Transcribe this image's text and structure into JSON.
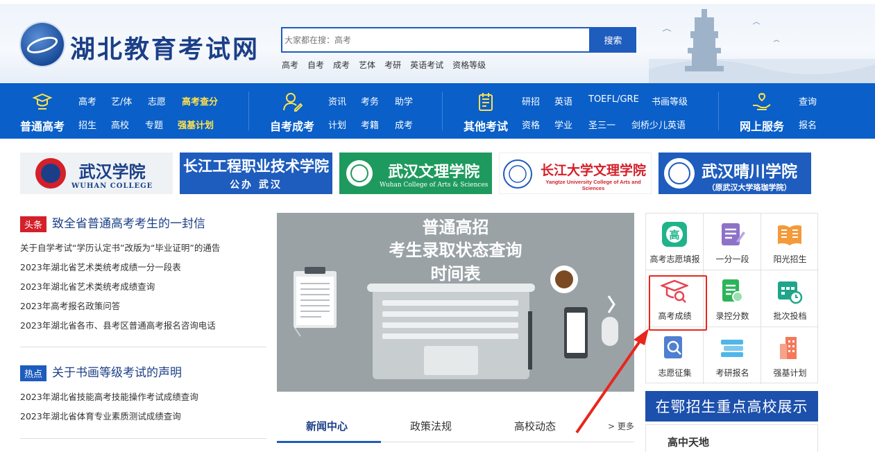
{
  "site": {
    "logo_text": "湖北教育考试网"
  },
  "search": {
    "placeholder": "大家都在搜：高考",
    "button": "搜索",
    "hot": [
      "高考",
      "自考",
      "成考",
      "艺体",
      "考研",
      "英语考试",
      "资格等级"
    ]
  },
  "nav": {
    "groups": [
      {
        "title": "普通高考",
        "icon": "graduation-cap-icon",
        "row1": [
          "高考",
          "艺/体",
          "志愿",
          "高考查分"
        ],
        "row2": [
          "招生",
          "高校",
          "专题",
          "强基计划"
        ]
      },
      {
        "title": "自考成考",
        "icon": "self-study-icon",
        "row1": [
          "资讯",
          "考务",
          "助学"
        ],
        "row2": [
          "计划",
          "考籍",
          "成考"
        ]
      },
      {
        "title": "其他考试",
        "icon": "notebook-icon",
        "row1": [
          "研招",
          "英语",
          "TOEFL/GRE",
          "书画等级"
        ],
        "row2": [
          "资格",
          "学业",
          "圣三一",
          "剑桥少儿英语"
        ]
      },
      {
        "title": "网上服务",
        "icon": "hand-heart-icon",
        "row1": [
          "查询"
        ],
        "row2": [
          "报名"
        ]
      }
    ]
  },
  "banners": [
    {
      "text": "武汉学院",
      "sub": "WUHAN COLLEGE",
      "bg": "#e9eef2",
      "fg": "#1b3f87"
    },
    {
      "text": "长江工程职业技术学院",
      "sub": "公办 武汉",
      "bg": "#1e5cbd",
      "fg": "#ffffff"
    },
    {
      "text": "武汉文理学院",
      "sub": "Wuhan College of Arts & Sciences",
      "bg": "#1f9a5e",
      "fg": "#ffffff"
    },
    {
      "text": "长江大学文理学院",
      "sub": "Yangtze University College of Arts and Sciences",
      "bg": "#ffffff",
      "fg": "#d4202a"
    },
    {
      "text": "武汉晴川学院",
      "sub": "（原武汉大学珞珈学院）",
      "bg": "#1e5cbd",
      "fg": "#ffffff"
    }
  ],
  "news": {
    "headline1_tag": "头条",
    "headline1": "致全省普通高考考生的一封信",
    "list1": [
      "关于自学考试“学历认定书”改版为“毕业证明”的通告",
      "2023年湖北省艺术类统考成绩一分一段表",
      "2023年湖北省艺术类统考成绩查询",
      "2023年高考报名政策问答",
      "2023年湖北省各市、县考区普通高考报名咨询电话"
    ],
    "headline2_tag": "热点",
    "headline2": "关于书画等级考试的声明",
    "list2": [
      "2023年湖北省技能高考技能操作考试成绩查询",
      "2023年湖北省体育专业素质测试成绩查询"
    ]
  },
  "slide": {
    "line1": "普通高招",
    "line2": "考生录取状态查询",
    "line3": "时间表"
  },
  "tabs": {
    "t1": "新闻中心",
    "t2": "政策法规",
    "t3": "高校动态",
    "more": "> 更多"
  },
  "services": [
    {
      "label": "高考志愿填报",
      "icon": "gao-badge-icon"
    },
    {
      "label": "一分一段",
      "icon": "document-edit-icon"
    },
    {
      "label": "阳光招生",
      "icon": "open-book-icon"
    },
    {
      "label": "高考成绩",
      "icon": "mortarboard-search-icon"
    },
    {
      "label": "录控分数",
      "icon": "score-search-icon"
    },
    {
      "label": "批次投档",
      "icon": "calendar-clock-icon"
    },
    {
      "label": "志愿征集",
      "icon": "file-search-icon"
    },
    {
      "label": "考研报名",
      "icon": "book-stack-icon"
    },
    {
      "label": "强基计划",
      "icon": "building-icon"
    }
  ],
  "showcase": {
    "title": "在鄂招生重点高校展示",
    "sub": "高中天地"
  },
  "colors": {
    "brand": "#0a5fc8",
    "accent": "#ffe24d",
    "highlight": "#e8261c"
  }
}
